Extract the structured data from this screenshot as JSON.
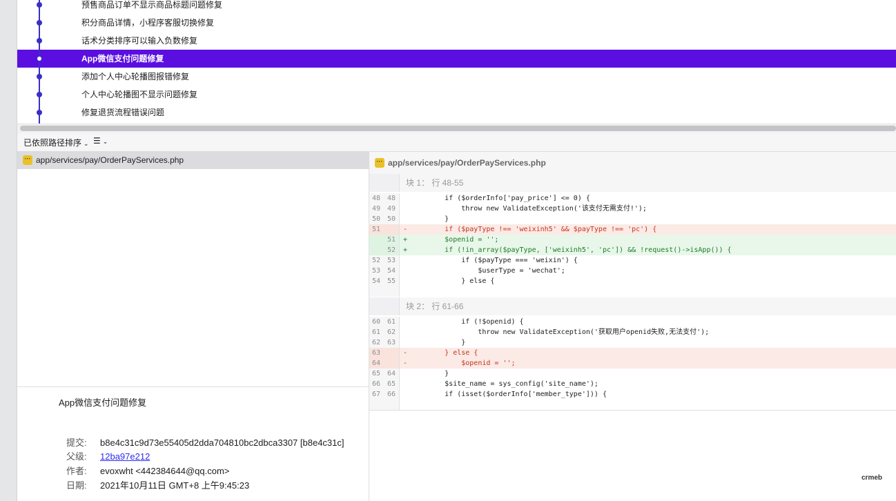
{
  "commit_list": {
    "items": [
      {
        "message": "预售商品订单不显示商品标题问题修复",
        "selected": false
      },
      {
        "message": "积分商品详情，小程序客服切换修复",
        "selected": false
      },
      {
        "message": "话术分类排序可以输入负数修复",
        "selected": false
      },
      {
        "message": "App微信支付问题修复",
        "selected": true
      },
      {
        "message": "添加个人中心轮播图报错修复",
        "selected": false
      },
      {
        "message": "个人中心轮播图不显示问题修复",
        "selected": false
      },
      {
        "message": "修复退货流程错误问题",
        "selected": false
      }
    ]
  },
  "toolbar": {
    "sort_label": "已依照路径排序",
    "view_icon": "list-icon"
  },
  "file_list": {
    "files": [
      {
        "path": "app/services/pay/OrderPayServices.php",
        "icon": "modified-file-icon"
      }
    ]
  },
  "details": {
    "subject": "App微信支付问题修复",
    "commit_label": "提交:",
    "commit_value": "b8e4c31c9d73e55405d2dda704810bc2dbca3307 [b8e4c31c]",
    "parent_label": "父级:",
    "parent_value": "12ba97e212",
    "author_label": "作者:",
    "author_value": "evoxwht <442384644@qq.com>",
    "date_label": "日期:",
    "date_value": "2021年10月11日 GMT+8 上午9:45:23"
  },
  "diff": {
    "file": "app/services/pay/OrderPayServices.php",
    "hunks": [
      {
        "title": "块 1： 行 48-55",
        "lines": [
          {
            "old": "48",
            "new": "48",
            "type": "ctx",
            "sign": "",
            "code": "        if ($orderInfo['pay_price'] <= 0) {"
          },
          {
            "old": "49",
            "new": "49",
            "type": "ctx",
            "sign": "",
            "code": "            throw new ValidateException('该支付无需支付!');"
          },
          {
            "old": "50",
            "new": "50",
            "type": "ctx",
            "sign": "",
            "code": "        }"
          },
          {
            "old": "51",
            "new": "",
            "type": "del",
            "sign": "-",
            "code": "        if ($payType !== 'weixinh5' && $payType !== 'pc') {"
          },
          {
            "old": "",
            "new": "51",
            "type": "add",
            "sign": "+",
            "code": "        $openid = '';"
          },
          {
            "old": "",
            "new": "52",
            "type": "add",
            "sign": "+",
            "code": "        if (!in_array($payType, ['weixinh5', 'pc']) && !request()->isApp()) {"
          },
          {
            "old": "52",
            "new": "53",
            "type": "ctx",
            "sign": "",
            "code": "            if ($payType === 'weixin') {"
          },
          {
            "old": "53",
            "new": "54",
            "type": "ctx",
            "sign": "",
            "code": "                $userType = 'wechat';"
          },
          {
            "old": "54",
            "new": "55",
            "type": "ctx",
            "sign": "",
            "code": "            } else {"
          }
        ]
      },
      {
        "title": "块 2： 行 61-66",
        "lines": [
          {
            "old": "60",
            "new": "61",
            "type": "ctx",
            "sign": "",
            "code": "            if (!$openid) {"
          },
          {
            "old": "61",
            "new": "62",
            "type": "ctx",
            "sign": "",
            "code": "                throw new ValidateException('获取用户openid失败,无法支付');"
          },
          {
            "old": "62",
            "new": "63",
            "type": "ctx",
            "sign": "",
            "code": "            }"
          },
          {
            "old": "63",
            "new": "",
            "type": "del",
            "sign": "-",
            "code": "        } else {"
          },
          {
            "old": "64",
            "new": "",
            "type": "del",
            "sign": "-",
            "code": "            $openid = '';"
          },
          {
            "old": "65",
            "new": "64",
            "type": "ctx",
            "sign": "",
            "code": "        }"
          },
          {
            "old": "66",
            "new": "65",
            "type": "ctx",
            "sign": "",
            "code": "        $site_name = sys_config('site_name');"
          },
          {
            "old": "67",
            "new": "66",
            "type": "ctx",
            "sign": "",
            "code": "        if (isset($orderInfo['member_type'])) {"
          }
        ]
      }
    ]
  },
  "watermark": "crmeb"
}
